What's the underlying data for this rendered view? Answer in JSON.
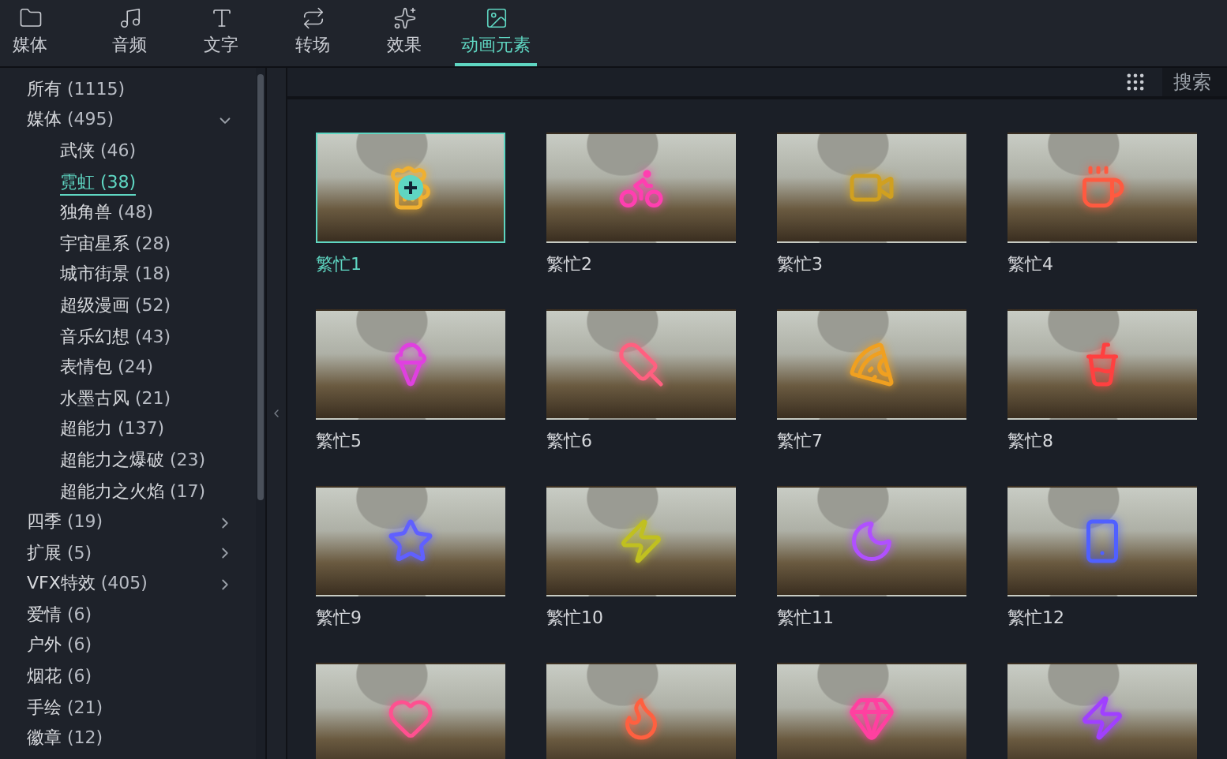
{
  "tabs": [
    {
      "label": "媒体",
      "selected": false
    },
    {
      "label": "音频",
      "selected": false
    },
    {
      "label": "文字",
      "selected": false
    },
    {
      "label": "转场",
      "selected": false
    },
    {
      "label": "效果",
      "selected": false
    },
    {
      "label": "动画元素",
      "selected": true
    }
  ],
  "sidebar": {
    "items": [
      {
        "label": "所有",
        "count": "(1115)",
        "selected": false
      },
      {
        "label": "媒体",
        "count": "(495)",
        "selected": false,
        "expanded": true,
        "children": [
          {
            "label": "武侠",
            "count": "(46)",
            "selected": false
          },
          {
            "label": "霓虹",
            "count": "(38)",
            "selected": true
          },
          {
            "label": "独角兽",
            "count": "(48)",
            "selected": false
          },
          {
            "label": "宇宙星系",
            "count": "(28)",
            "selected": false
          },
          {
            "label": "城市街景",
            "count": "(18)",
            "selected": false
          },
          {
            "label": "超级漫画",
            "count": "(52)",
            "selected": false
          },
          {
            "label": "音乐幻想",
            "count": "(43)",
            "selected": false
          },
          {
            "label": "表情包",
            "count": "(24)",
            "selected": false
          },
          {
            "label": "水墨古风",
            "count": "(21)",
            "selected": false
          },
          {
            "label": "超能力",
            "count": "(137)",
            "selected": false
          },
          {
            "label": "超能力之爆破",
            "count": "(23)",
            "selected": false
          },
          {
            "label": "超能力之火焰",
            "count": "(17)",
            "selected": false
          }
        ]
      },
      {
        "label": "四季",
        "count": "(19)",
        "selected": false,
        "expanded": false
      },
      {
        "label": "扩展",
        "count": "(5)",
        "selected": false,
        "expanded": false
      },
      {
        "label": "VFX特效",
        "count": "(405)",
        "selected": false,
        "expanded": false
      },
      {
        "label": "爱情",
        "count": "(6)",
        "selected": false
      },
      {
        "label": "户外",
        "count": "(6)",
        "selected": false
      },
      {
        "label": "烟花",
        "count": "(6)",
        "selected": false
      },
      {
        "label": "手绘",
        "count": "(21)",
        "selected": false
      },
      {
        "label": "徽章",
        "count": "(12)",
        "selected": false
      }
    ]
  },
  "search": {
    "placeholder": "搜索"
  },
  "items": [
    {
      "name": "繁忙1",
      "selected": true,
      "color": "#f0b030"
    },
    {
      "name": "繁忙2",
      "selected": false,
      "color": "#ff3fb0"
    },
    {
      "name": "繁忙3",
      "selected": false,
      "color": "#d0a020"
    },
    {
      "name": "繁忙4",
      "selected": false,
      "color": "#ff5a40"
    },
    {
      "name": "繁忙5",
      "selected": false,
      "color": "#e040e0"
    },
    {
      "name": "繁忙6",
      "selected": false,
      "color": "#ff6080"
    },
    {
      "name": "繁忙7",
      "selected": false,
      "color": "#f0a020"
    },
    {
      "name": "繁忙8",
      "selected": false,
      "color": "#ff4040"
    },
    {
      "name": "繁忙9",
      "selected": false,
      "color": "#6060ff"
    },
    {
      "name": "繁忙10",
      "selected": false,
      "color": "#c0c020"
    },
    {
      "name": "繁忙11",
      "selected": false,
      "color": "#b050ff"
    },
    {
      "name": "繁忙12",
      "selected": false,
      "color": "#5060ff"
    },
    {
      "selected": false,
      "color": "#ff5090"
    },
    {
      "selected": false,
      "color": "#ff6040"
    },
    {
      "selected": false,
      "color": "#ff40a0"
    },
    {
      "selected": false,
      "color": "#a040ff"
    }
  ]
}
